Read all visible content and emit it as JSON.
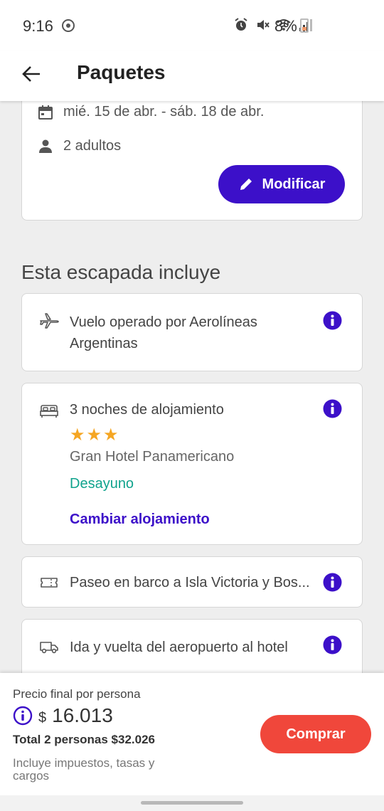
{
  "status_bar": {
    "time": "9:16",
    "battery_percent": "8%"
  },
  "app_bar": {
    "title": "Paquetes"
  },
  "search_summary": {
    "dates": "mié. 15 de abr. - sáb. 18 de abr.",
    "travelers": "2 adultos",
    "modify_label": "Modificar"
  },
  "section_title": "Esta escapada incluye",
  "items": [
    {
      "text_line1": "Vuelo operado por Aerolíneas",
      "text_line2": "Argentinas"
    },
    {
      "text": "3 noches de alojamiento",
      "stars": "★★★",
      "star_count": 3,
      "hotel_name": "Gran Hotel Panamericano",
      "meal_plan": "Desayuno",
      "change_link": "Cambiar alojamiento"
    },
    {
      "text": "Paseo en barco a Isla Victoria y Bos..."
    },
    {
      "text": "Ida y vuelta del aeropuerto al hotel"
    }
  ],
  "price": {
    "label": "Precio final por persona",
    "currency": "$",
    "amount": "16.013",
    "total": "Total 2 personas $32.026",
    "taxes": "Incluye impuestos, tasas y cargos",
    "buy_label": "Comprar"
  },
  "colors": {
    "primary": "#3c10c9",
    "buy": "#f0473b",
    "meal": "#10a38d",
    "star": "#f5a623"
  }
}
